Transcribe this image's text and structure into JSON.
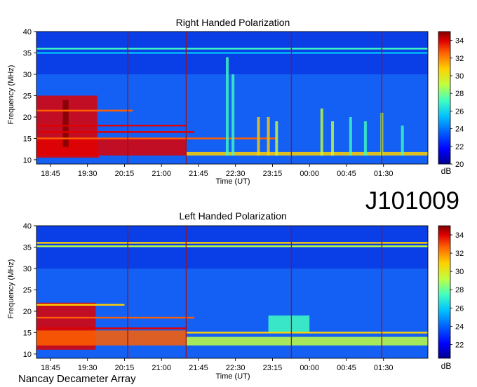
{
  "observation_id": "J101009",
  "instrument": "Nancay Decameter Array",
  "colors": {
    "colormap": [
      "#00008f",
      "#0000ff",
      "#0060ff",
      "#00c0ff",
      "#40ffc0",
      "#c0ff40",
      "#ffd000",
      "#ff6000",
      "#e00000",
      "#800000"
    ],
    "background": "#ffffff"
  },
  "chart_data": [
    {
      "type": "heatmap",
      "title": "Right Handed Polarization",
      "xlabel": "Time (UT)",
      "ylabel": "Frequency (MHz)",
      "x_ticks": [
        "18:45",
        "19:30",
        "20:15",
        "21:00",
        "21:45",
        "22:30",
        "23:15",
        "00:00",
        "00:45",
        "01:30"
      ],
      "x_tick_minutes": [
        1125,
        1170,
        1215,
        1260,
        1305,
        1350,
        1395,
        1440,
        1485,
        1530
      ],
      "xlim_minutes": [
        1108,
        1584
      ],
      "y_ticks": [
        10,
        15,
        20,
        25,
        30,
        35,
        40
      ],
      "ylim": [
        9,
        40
      ],
      "colorbar": {
        "label": "dB",
        "ticks": [
          20,
          22,
          24,
          26,
          28,
          30,
          32,
          34
        ],
        "range": [
          20,
          35
        ]
      },
      "bands": [
        {
          "x": [
            1108,
            1182
          ],
          "y": [
            11,
            25
          ],
          "level": 33
        },
        {
          "x": [
            1108,
            1290
          ],
          "y": [
            11,
            15
          ],
          "level": 32
        },
        {
          "x": [
            1140,
            1147
          ],
          "y": [
            13,
            24
          ],
          "level": 34
        },
        {
          "x": [
            1108,
            1184
          ],
          "y": [
            10.5,
            11.5
          ],
          "level": 33
        },
        {
          "x": [
            1290,
            1584
          ],
          "y": [
            11,
            11.8
          ],
          "level": 30
        }
      ],
      "lines": [
        {
          "x": [
            1108,
            1225
          ],
          "y": 21.5,
          "level": 31
        },
        {
          "x": [
            1108,
            1290
          ],
          "y": 18,
          "level": 32
        },
        {
          "x": [
            1108,
            1300
          ],
          "y": 16.5,
          "level": 33
        },
        {
          "x": [
            1108,
            1400
          ],
          "y": 15,
          "level": 31
        },
        {
          "x": [
            1108,
            1584
          ],
          "y": 36,
          "level": 27
        },
        {
          "x": [
            1108,
            1584
          ],
          "y": 35,
          "level": 25
        }
      ],
      "bursts": [
        {
          "x": 1340,
          "y": [
            11,
            34
          ],
          "level": 26
        },
        {
          "x": 1347,
          "y": [
            11,
            30
          ],
          "level": 26
        },
        {
          "x": 1378,
          "y": [
            11,
            20
          ],
          "level": 29
        },
        {
          "x": 1390,
          "y": [
            11,
            20
          ],
          "level": 29
        },
        {
          "x": 1400,
          "y": [
            11,
            19
          ],
          "level": 28
        },
        {
          "x": 1455,
          "y": [
            11,
            22
          ],
          "level": 28
        },
        {
          "x": 1468,
          "y": [
            11,
            19
          ],
          "level": 28
        },
        {
          "x": 1490,
          "y": [
            11,
            20
          ],
          "level": 27
        },
        {
          "x": 1508,
          "y": [
            11,
            19
          ],
          "level": 27
        },
        {
          "x": 1528,
          "y": [
            11,
            21
          ],
          "level": 28
        },
        {
          "x": 1553,
          "y": [
            11,
            18
          ],
          "level": 26
        }
      ],
      "markers": [
        1219,
        1290,
        1418,
        1528
      ]
    },
    {
      "type": "heatmap",
      "title": "Left Handed Polarization",
      "xlabel": "Time (UT)",
      "ylabel": "Frequency (MHz)",
      "x_ticks": [
        "18:45",
        "19:30",
        "20:15",
        "21:00",
        "21:45",
        "22:30",
        "23:15",
        "00:00",
        "00:45",
        "01:30"
      ],
      "x_tick_minutes": [
        1125,
        1170,
        1215,
        1260,
        1305,
        1350,
        1395,
        1440,
        1485,
        1530
      ],
      "xlim_minutes": [
        1108,
        1584
      ],
      "y_ticks": [
        10,
        15,
        20,
        25,
        30,
        35,
        40
      ],
      "ylim": [
        9,
        40
      ],
      "colorbar": {
        "label": "dB",
        "ticks": [
          22,
          24,
          26,
          28,
          30,
          32,
          34
        ],
        "range": [
          20.5,
          35
        ]
      },
      "bands": [
        {
          "x": [
            1108,
            1180
          ],
          "y": [
            11,
            22
          ],
          "level": 33
        },
        {
          "x": [
            1108,
            1290
          ],
          "y": [
            12,
            15.5
          ],
          "level": 32
        },
        {
          "x": [
            1290,
            1584
          ],
          "y": [
            12,
            14
          ],
          "level": 28
        },
        {
          "x": [
            1390,
            1440
          ],
          "y": [
            15,
            19
          ],
          "level": 27
        }
      ],
      "lines": [
        {
          "x": [
            1108,
            1215
          ],
          "y": 21.5,
          "level": 30
        },
        {
          "x": [
            1108,
            1300
          ],
          "y": 18.5,
          "level": 31
        },
        {
          "x": [
            1108,
            1290
          ],
          "y": 16,
          "level": 33
        },
        {
          "x": [
            1108,
            1584
          ],
          "y": 36,
          "level": 30
        },
        {
          "x": [
            1108,
            1584
          ],
          "y": 35.2,
          "level": 29
        },
        {
          "x": [
            1290,
            1584
          ],
          "y": 15,
          "level": 30
        }
      ],
      "bursts": [],
      "markers": [
        1219,
        1290,
        1418,
        1528
      ]
    }
  ]
}
